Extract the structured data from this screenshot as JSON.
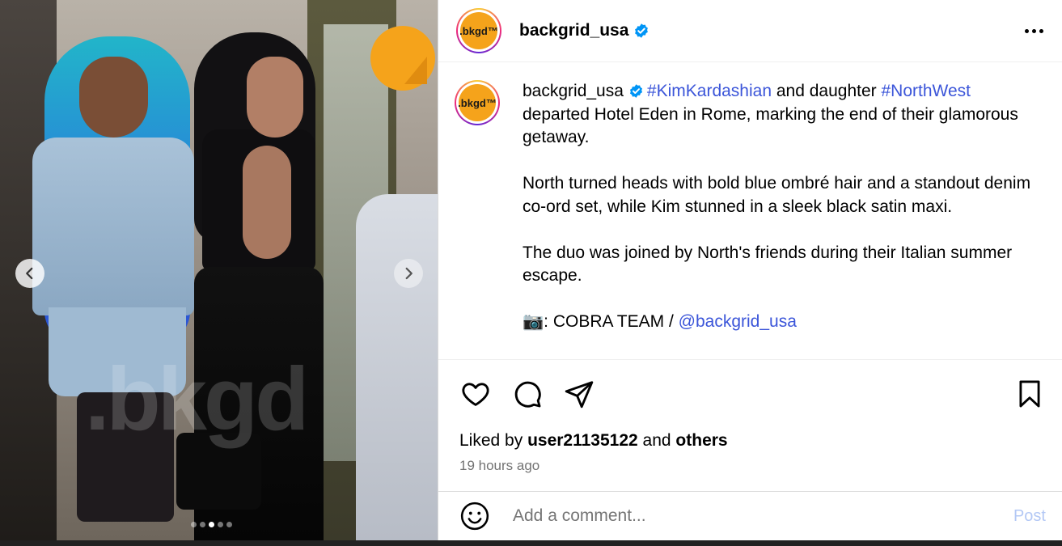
{
  "header": {
    "username": "backgrid_usa",
    "avatar_text": ".bkgd™"
  },
  "media": {
    "watermark": ".bkgd",
    "dots_count": 5,
    "active_dot": 2
  },
  "caption": {
    "username": "backgrid_usa",
    "avatar_text": ".bkgd™",
    "tag1": "#KimKardashian",
    "text1": " and daughter ",
    "tag2": "#NorthWest",
    "text2": " departed Hotel Eden in Rome, marking the end of their glamorous getaway.",
    "para2": "North turned heads with bold blue ombré hair and a standout denim co-ord set, while Kim stunned in a sleek black satin maxi.",
    "para3": "The duo was joined by North's friends during their Italian summer escape.",
    "credit_emoji": "📷",
    "credit_text": ": COBRA TEAM / ",
    "credit_mention": "@backgrid_usa"
  },
  "likes": {
    "prefix": "Liked by ",
    "user": "user21135122",
    "middle": " and ",
    "others": "others"
  },
  "time": "19 hours ago",
  "comment": {
    "placeholder": "Add a comment...",
    "post_label": "Post"
  },
  "colors": {
    "link": "#3b55d9",
    "verified": "#0095f6",
    "post_disabled": "#b3c8f5"
  },
  "icons": [
    "heart-icon",
    "comment-icon",
    "share-icon",
    "bookmark-icon",
    "emoji-icon",
    "verified-badge-icon",
    "more-options-icon",
    "chevron-left-icon",
    "chevron-right-icon"
  ]
}
